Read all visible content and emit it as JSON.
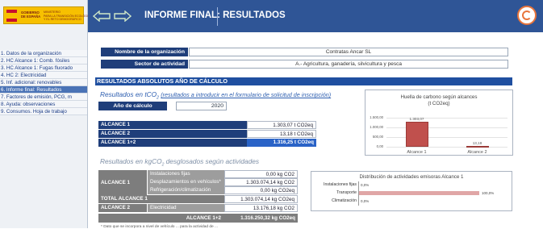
{
  "sidebar": {
    "logo_line1": "GOBIERNO\nDE ESPAÑA",
    "logo_line2": "MINISTERIO\nPARA LA TRANSICIÓN ECOLÓGICA\nY EL RETO DEMOGRÁFICO",
    "items": [
      {
        "label": "1. Datos de la organización"
      },
      {
        "label": "2. HC Alcance 1: Comb. fósiles"
      },
      {
        "label": "3. HC Alcance 1: Fugas fluorado"
      },
      {
        "label": "4. HC 2: Electricidad"
      },
      {
        "label": "5. Inf. adicional: renovables"
      },
      {
        "label": "6. Informe final: Resultados"
      },
      {
        "label": "7. Factores de emisión, PCG, m"
      },
      {
        "label": "8. Ayuda: observaciones"
      },
      {
        "label": "9. Consumos. Hoja de trabajo"
      }
    ],
    "active_index": 5
  },
  "header": {
    "title": "INFORME FINAL: RESULTADOS"
  },
  "org": {
    "name_label": "Nombre de la organización",
    "name_value": "Contratas Ancar SL",
    "sector_label": "Sector de actividad",
    "sector_value": "A.- Agricultura, ganadería, silvicultura y pesca"
  },
  "section_title": "RESULTADOS ABSOLUTOS AÑO DE CÁLCULO",
  "results_tco2": {
    "heading": "Resultados en tCO",
    "heading_sub": "2",
    "heading_link": "(resultados a introducir en el formulario de solicitud de inscripción)",
    "year_label": "Año de cálculo",
    "year_value": "2020",
    "rows": [
      {
        "label": "ALCANCE 1",
        "value": "1.303,07 t CO2eq"
      },
      {
        "label": "ALCANCE 2",
        "value": "13,18 t CO2eq"
      },
      {
        "label": "ALCANCE 1+2",
        "value": "1.316,25 t CO2eq"
      }
    ]
  },
  "results_kg": {
    "heading": "Resultados en kgCO",
    "heading_sub": "2",
    "heading_rest": " desglosados según actividades",
    "alcance1_label": "ALCANCE 1",
    "rows": [
      {
        "label": "Instalaciones fijas",
        "value": "0,00 kg CO2"
      },
      {
        "label": "Desplazamientos en vehículos*",
        "value": "1.303.074,14 kg CO2"
      },
      {
        "label": "Refrigeración/climatización",
        "value": "0,00 kg CO2eq"
      }
    ],
    "total_label": "TOTAL ALCANCE 1",
    "total_value": "1.303.074,14 kg CO2eq",
    "alcance2_label": "ALCANCE 2",
    "alcance2_sub": "Electricidad",
    "alcance2_value": "13.176,18 kg CO2",
    "sum_label": "ALCANCE 1+2",
    "sum_value": "1.316.250,32 kg CO2eq",
    "footnote": "* Dato que se incorpora a nivel de vehículo ... para la actividad de ..."
  },
  "chart_data": [
    {
      "type": "bar",
      "title": "Huella de carbono según alcances",
      "subtitle": "(t CO2eq)",
      "categories": [
        "Alcance 1",
        "Alcance 2"
      ],
      "values": [
        1303.07,
        13.18
      ],
      "data_labels": [
        "1.303,07",
        "13,18"
      ],
      "y_ticks": [
        "1.500,00",
        "1.000,00",
        "500,00",
        "0,00"
      ],
      "ylim": [
        0,
        1500
      ],
      "colors": [
        "#c0504d",
        "#c0504d"
      ]
    },
    {
      "type": "bar",
      "orientation": "horizontal",
      "title": "Distribución de actividades emisoras  Alcance 1",
      "categories": [
        "Instalaciones fijas",
        "Transporte",
        "Climatización"
      ],
      "values": [
        0,
        100,
        0
      ],
      "data_labels": [
        "0,0%",
        "100,0%",
        "0,0%"
      ],
      "xlim": [
        0,
        100
      ],
      "colors": [
        "#e0a6a6",
        "#e0a6a6",
        "#e0a6a6"
      ]
    }
  ]
}
